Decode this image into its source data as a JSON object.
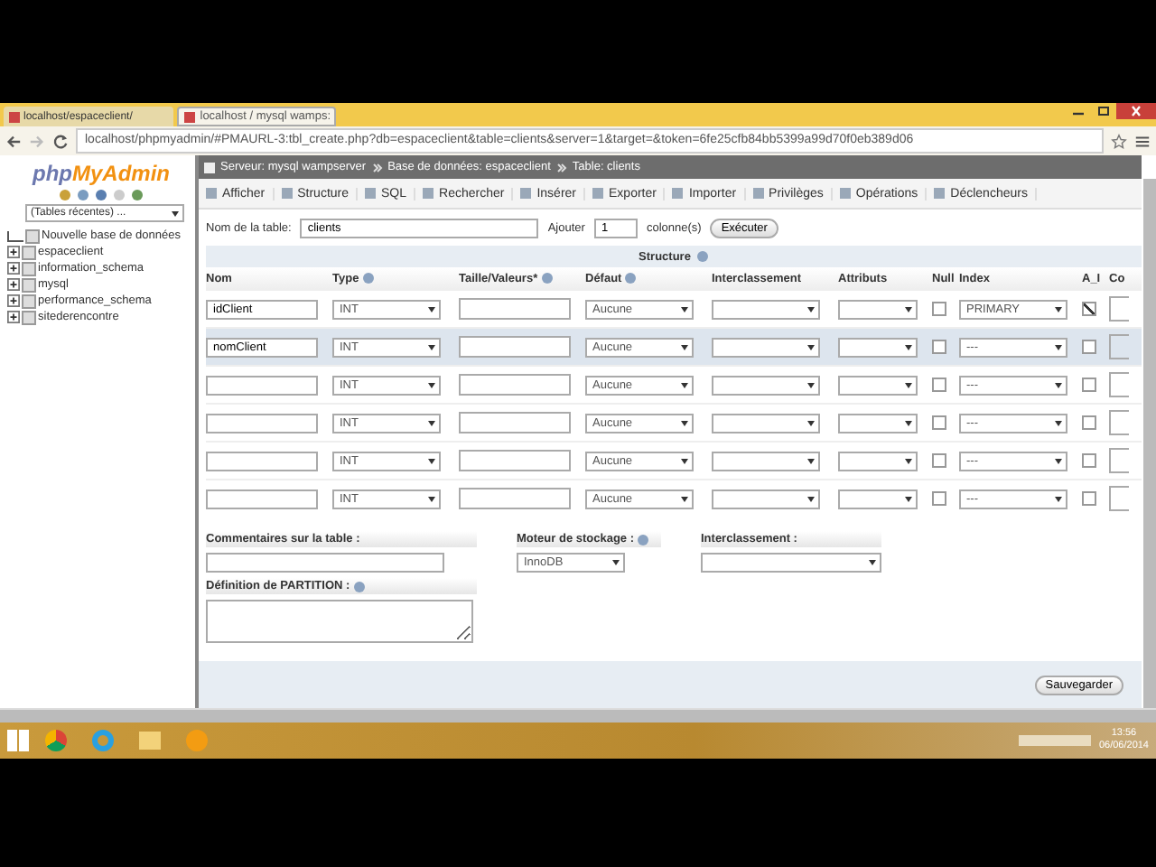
{
  "browser": {
    "tabs": [
      {
        "label": "localhost/espaceclient/",
        "selected": false
      },
      {
        "label": "localhost / mysql wamps:",
        "selected": true
      }
    ],
    "address": "localhost/phpmyadmin/#PMAURL-3:tbl_create.php?db=espaceclient&table=clients&server=1&target=&token=6fe25cfb84bb5399a99d70f0eb389d06"
  },
  "sidebar": {
    "logo": {
      "part_1": "php",
      "part_2": "MyAdmin"
    },
    "recent": "(Tables récentes) ...",
    "databases": [
      {
        "name": "Nouvelle base de données",
        "kind": "new"
      },
      {
        "name": "espaceclient",
        "kind": "db"
      },
      {
        "name": "information_schema",
        "kind": "db"
      },
      {
        "name": "mysql",
        "kind": "db"
      },
      {
        "name": "performance_schema",
        "kind": "db"
      },
      {
        "name": "sitederencontre",
        "kind": "db"
      }
    ]
  },
  "breadcrumb": [
    "Serveur: mysql wampserver",
    "Base de données: espaceclient",
    "Table: clients"
  ],
  "tabs": [
    "Afficher",
    "Structure",
    "SQL",
    "Rechercher",
    "Insérer",
    "Exporter",
    "Importer",
    "Privilèges",
    "Opérations",
    "Déclencheurs"
  ],
  "table_name": {
    "label": "Nom de la table:",
    "value": "clients",
    "add_label": "Ajouter",
    "add_value": "1",
    "columns_label": "colonne(s)",
    "execute": "Exécuter"
  },
  "structure": {
    "title": "Structure",
    "columns": [
      {
        "label": "Nom",
        "help": false
      },
      {
        "label": "Type",
        "help": true
      },
      {
        "label": "Taille/Valeurs*",
        "help": true
      },
      {
        "label": "Défaut",
        "help": true
      },
      {
        "label": "Interclassement",
        "help": false
      },
      {
        "label": "Attributs",
        "help": false
      },
      {
        "label": "Null",
        "help": false
      },
      {
        "label": "Index",
        "help": false
      },
      {
        "label": "A_I",
        "help": false
      },
      {
        "label": "Co",
        "help": false
      }
    ],
    "rows": [
      {
        "name": "idClient",
        "type": "INT",
        "default": "Aucune",
        "null": false,
        "index": "PRIMARY",
        "ai": true,
        "highlighted": false
      },
      {
        "name": "nomClient",
        "type": "INT",
        "default": "Aucune",
        "null": false,
        "index": "---",
        "ai": false,
        "highlighted": true
      },
      {
        "name": "",
        "type": "INT",
        "default": "Aucune",
        "null": false,
        "index": "---",
        "ai": false,
        "highlighted": false
      },
      {
        "name": "",
        "type": "INT",
        "default": "Aucune",
        "null": false,
        "index": "---",
        "ai": false,
        "highlighted": false
      },
      {
        "name": "",
        "type": "INT",
        "default": "Aucune",
        "null": false,
        "index": "---",
        "ai": false,
        "highlighted": false
      },
      {
        "name": "",
        "type": "INT",
        "default": "Aucune",
        "null": false,
        "index": "---",
        "ai": false,
        "highlighted": false
      }
    ]
  },
  "options": {
    "comments_label": "Commentaires sur la table :",
    "engine_label": "Moteur de stockage :",
    "engine_value": "InnoDB",
    "collation_label": "Interclassement :",
    "partition_label": "Définition de PARTITION :"
  },
  "save": "Sauvegarder",
  "taskbar": {
    "time": "13:56",
    "date": "06/06/2014"
  }
}
